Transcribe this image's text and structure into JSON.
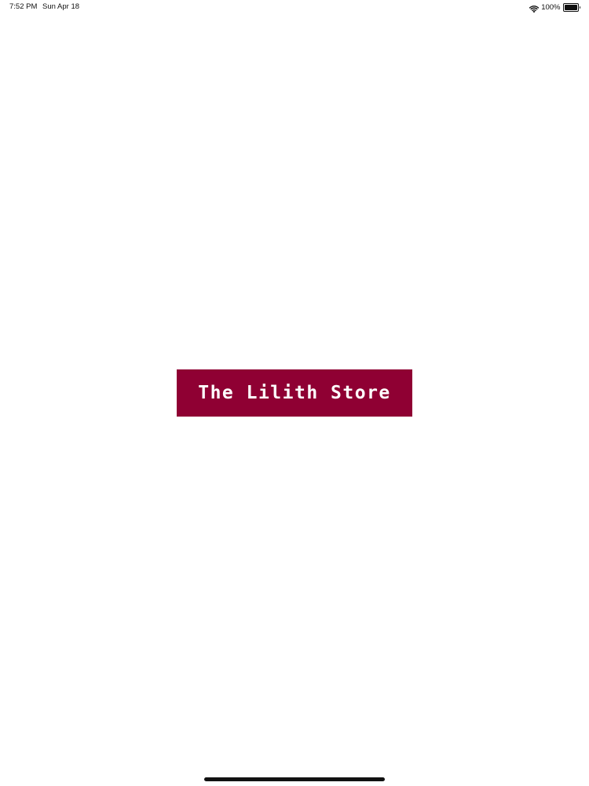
{
  "status_bar": {
    "time": "7:52 PM",
    "date": "Sun Apr 18",
    "battery_percent": "100%",
    "battery_level": 1.0,
    "wifi_icon": "wifi-icon",
    "battery_icon": "battery-icon"
  },
  "splash": {
    "logo_text": "The Lilith Store",
    "logo_bg_color": "#8f0033",
    "logo_text_color": "#ffffff"
  },
  "home_indicator": {
    "icon": "home-indicator"
  }
}
